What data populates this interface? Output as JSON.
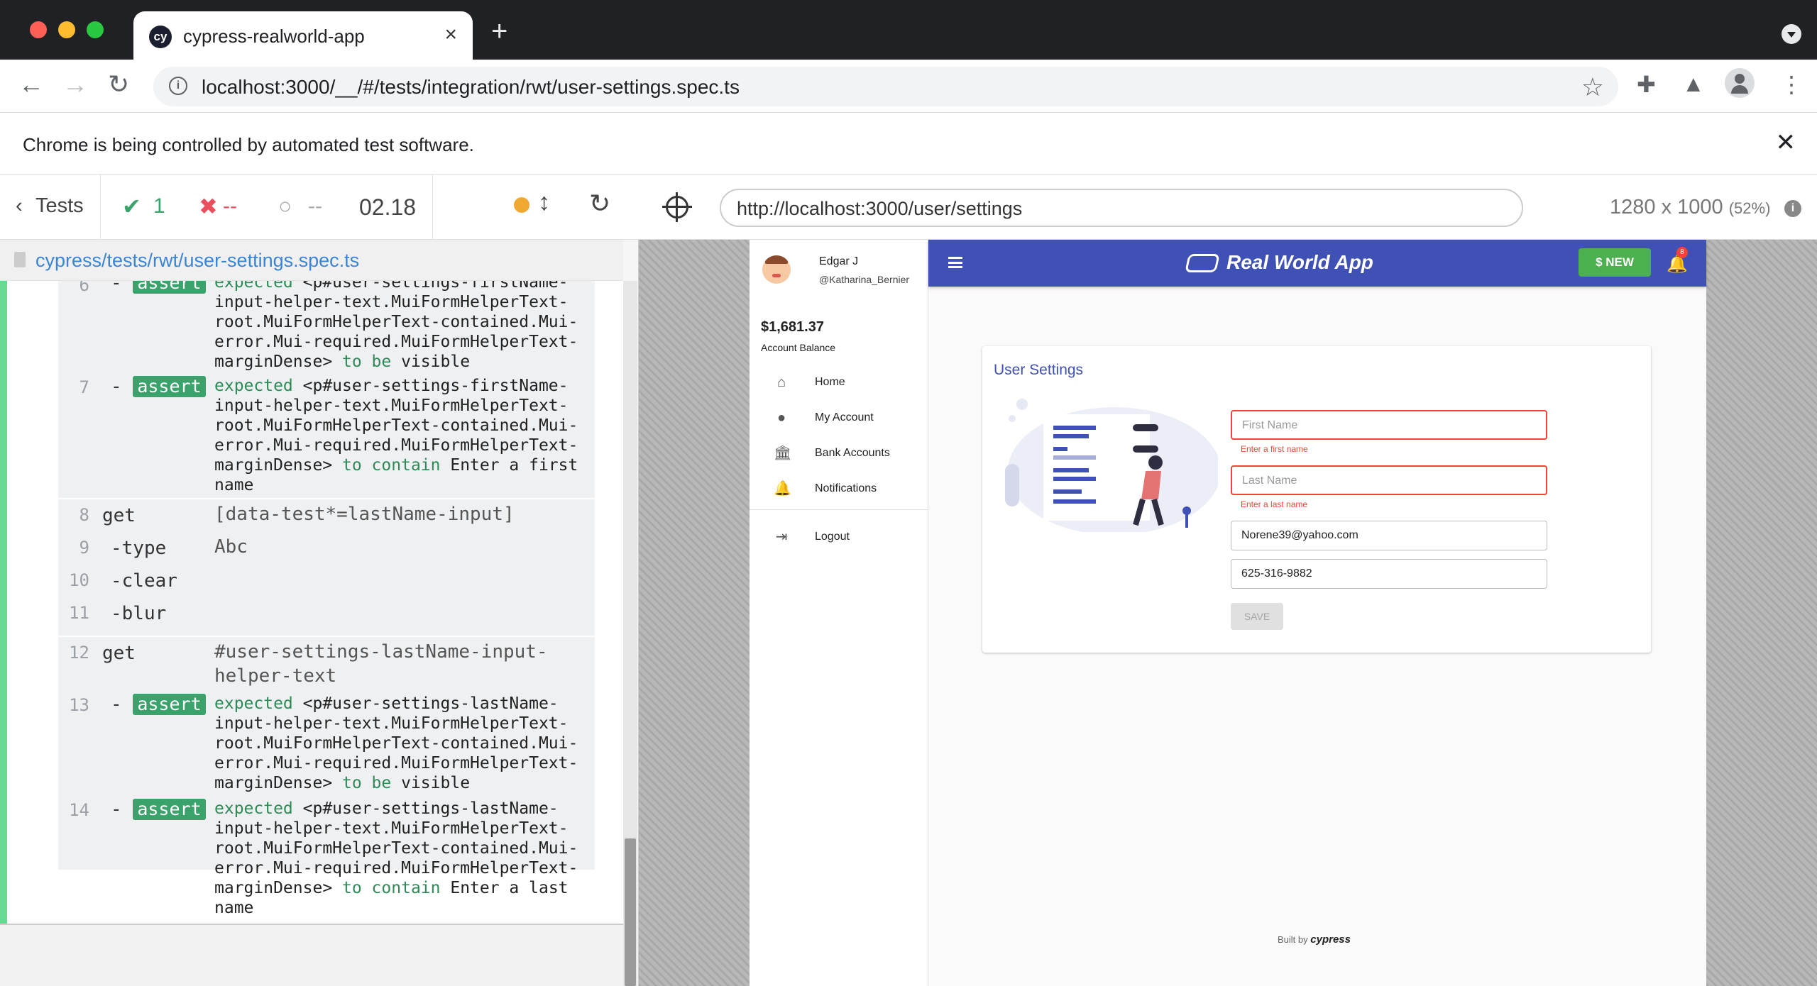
{
  "browser": {
    "tab_title": "cypress-realworld-app",
    "tab_logo": "cy",
    "new_tab": "+",
    "url": "localhost:3000/__/#/tests/integration/rwt/user-settings.spec.ts",
    "infobar_text": "Chrome is being controlled by automated test software.",
    "infobar_close": "✕"
  },
  "reporter": {
    "tests_label": "Tests",
    "passed_count": "1",
    "failed_count": "--",
    "pending_count": "--",
    "duration": "02.18",
    "spec_path": "cypress/tests/rwt/user-settings.spec.ts",
    "commands_top": [
      {
        "num": "6",
        "name": "assert",
        "msg_parts": [
          "expected ",
          "<p#user-settings-firstName-input-helper-text.MuiFormHelperText-root.MuiFormHelperText-contained.Mui-error.Mui-required.MuiFormHelperText-marginDense>",
          " to be ",
          "visible"
        ]
      },
      {
        "num": "7",
        "name": "assert",
        "msg_parts": [
          "expected ",
          "<p#user-settings-firstName-input-helper-text.MuiFormHelperText-root.MuiFormHelperText-contained.Mui-error.Mui-required.MuiFormHelperText-marginDense>",
          " to contain ",
          "Enter a first name"
        ]
      }
    ],
    "commands_get": [
      {
        "num": "8",
        "name": "get",
        "msg": "[data-test*=lastName-input]"
      },
      {
        "num": "9",
        "name": "-type",
        "msg": "Abc"
      },
      {
        "num": "10",
        "name": "-clear",
        "msg": ""
      },
      {
        "num": "11",
        "name": "-blur",
        "msg": ""
      },
      {
        "num": "12",
        "name": "get",
        "msg": "#user-settings-lastName-input-\nhelper-text"
      }
    ],
    "commands_bottom": [
      {
        "num": "13",
        "name": "assert",
        "msg_parts": [
          "expected ",
          "<p#user-settings-lastName-input-helper-text.MuiFormHelperText-root.MuiFormHelperText-contained.Mui-error.Mui-required.MuiFormHelperText-marginDense>",
          " to be ",
          "visible"
        ]
      },
      {
        "num": "14",
        "name": "assert",
        "msg_parts": [
          "expected ",
          "<p#user-settings-lastName-input-helper-text.MuiFormHelperText-root.MuiFormHelperText-contained.Mui-error.Mui-required.MuiFormHelperText-marginDense>",
          " to contain ",
          "Enter a last name"
        ]
      }
    ]
  },
  "aut": {
    "url": "http://localhost:3000/user/settings",
    "viewport": "1280 x 1000",
    "scale": "(52%)"
  },
  "app": {
    "user_name": "Edgar J",
    "user_handle": "@Katharina_Bernier",
    "balance": "$1,681.37",
    "balance_label": "Account Balance",
    "nav": [
      "Home",
      "My Account",
      "Bank Accounts",
      "Notifications",
      "Logout"
    ],
    "brand": "Real World App",
    "new_button": "$ NEW",
    "notif_count": "8",
    "card_title": "User Settings",
    "fields": {
      "first_name_placeholder": "First Name",
      "first_name_error": "Enter a first name",
      "last_name_placeholder": "Last Name",
      "last_name_error": "Enter a last name",
      "email": "Norene39@yahoo.com",
      "phone": "625-316-9882"
    },
    "save_button": "SAVE",
    "footer_prefix": "Built by",
    "footer_brand": "cypress"
  },
  "colors": {
    "app_bar": "#3f51b5",
    "new_button": "#4caf50",
    "error": "#f44336",
    "passed": "#4bd37f",
    "failed": "#e94f5f"
  }
}
